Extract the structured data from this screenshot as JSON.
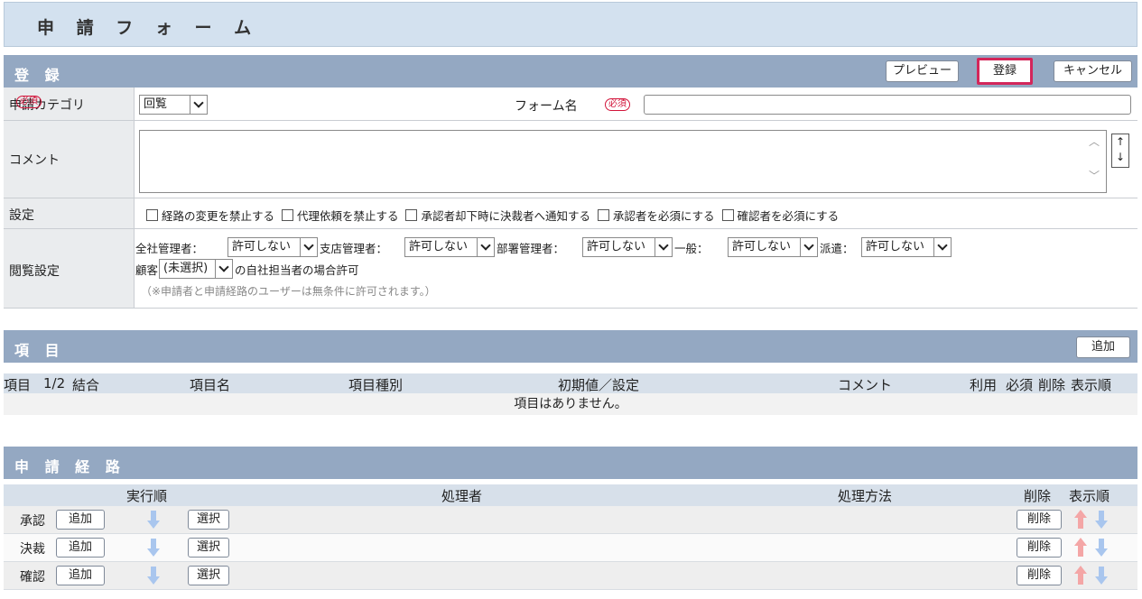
{
  "title": "申 請 フ ォ ー ム",
  "register_section": {
    "title": "登 録",
    "buttons": {
      "preview": "プレビュー",
      "register": "登録",
      "cancel": "キャンセル"
    }
  },
  "form": {
    "category": {
      "label": "申請カテゴリ",
      "required": "必須",
      "value": "回覧"
    },
    "form_name": {
      "label": "フォーム名",
      "required": "必須",
      "value": ""
    },
    "comment": {
      "label": "コメント",
      "value": ""
    },
    "settings": {
      "label": "設定",
      "options": [
        "経路の変更を禁止する",
        "代理依頼を禁止する",
        "承認者却下時に決裁者へ通知する",
        "承認者を必須にする",
        "確認者を必須にする"
      ]
    },
    "view": {
      "label": "閲覧設定",
      "company_admin": {
        "label": "全社管理者：",
        "value": "許可しない"
      },
      "branch_admin": {
        "label": "支店管理者：",
        "value": "許可しない"
      },
      "dept_admin": {
        "label": "部署管理者：",
        "value": "許可しない"
      },
      "general": {
        "label": "一般：",
        "value": "許可しない"
      },
      "dispatch": {
        "label": "派遣：",
        "value": "許可しない"
      },
      "customer": {
        "label": "顧客",
        "value": "(未選択)",
        "suffix": "の自社担当者の場合許可"
      },
      "note": "（※申請者と申請経路のユーザーは無条件に許可されます。）"
    }
  },
  "items_section": {
    "title": "項 目",
    "add_button": "追加",
    "columns": {
      "item": "項目",
      "half": "1/2",
      "join": "結合",
      "name": "項目名",
      "type": "項目種別",
      "initial": "初期値／設定",
      "comment": "コメント",
      "use": "利用",
      "required": "必須",
      "delete": "削除",
      "order": "表示順"
    },
    "empty": "項目はありません。"
  },
  "route_section": {
    "title": "申 請 経 路",
    "columns": {
      "exec_order": "実行順",
      "processor": "処理者",
      "method": "処理方法",
      "delete": "削除",
      "order": "表示順"
    },
    "rows": [
      {
        "label": "承認",
        "add": "追加",
        "select": "選択",
        "delete": "削除"
      },
      {
        "label": "決裁",
        "add": "追加",
        "select": "選択",
        "delete": "削除"
      },
      {
        "label": "確認",
        "add": "追加",
        "select": "選択",
        "delete": "削除"
      }
    ]
  }
}
